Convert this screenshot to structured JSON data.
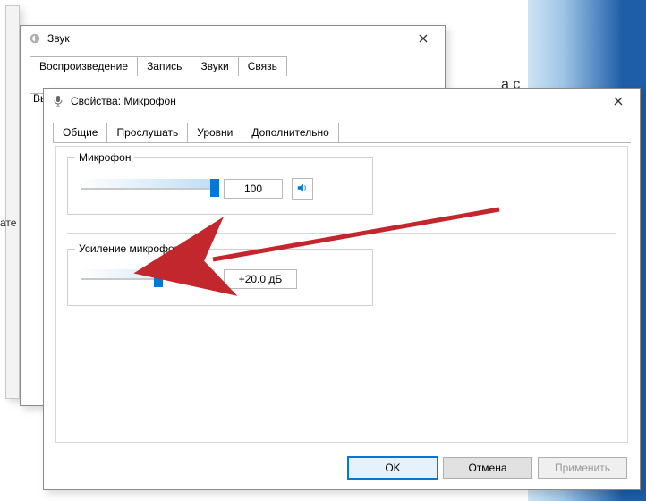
{
  "back_window": {
    "title": "Звук",
    "tabs": [
      "Воспроизведение",
      "Запись",
      "Звуки",
      "Связь"
    ],
    "active_tab_index": 1,
    "hint": "Выберите устройство записи, параметры которого нужно изменить:"
  },
  "front_window": {
    "title": "Свойства: Микрофон",
    "tabs": [
      "Общие",
      "Прослушать",
      "Уровни",
      "Дополнительно"
    ],
    "active_tab_index": 2,
    "group_mic": {
      "label": "Микрофон",
      "value": "100",
      "slider_pct": 100
    },
    "group_boost": {
      "label": "Усиление микрофона",
      "value": "+20.0 дБ",
      "slider_pct": 58
    },
    "buttons": {
      "ok": "OK",
      "cancel": "Отмена",
      "apply": "Применить"
    }
  },
  "background_fragments": {
    "right1": "а с"
  },
  "left_label_fragment": "ате",
  "icons": {
    "sound": "sound-icon",
    "mic": "microphone-icon",
    "speaker": "speaker-icon",
    "close": "close-icon"
  },
  "accent": "#0078d7",
  "arrow_color": "#c1272d"
}
